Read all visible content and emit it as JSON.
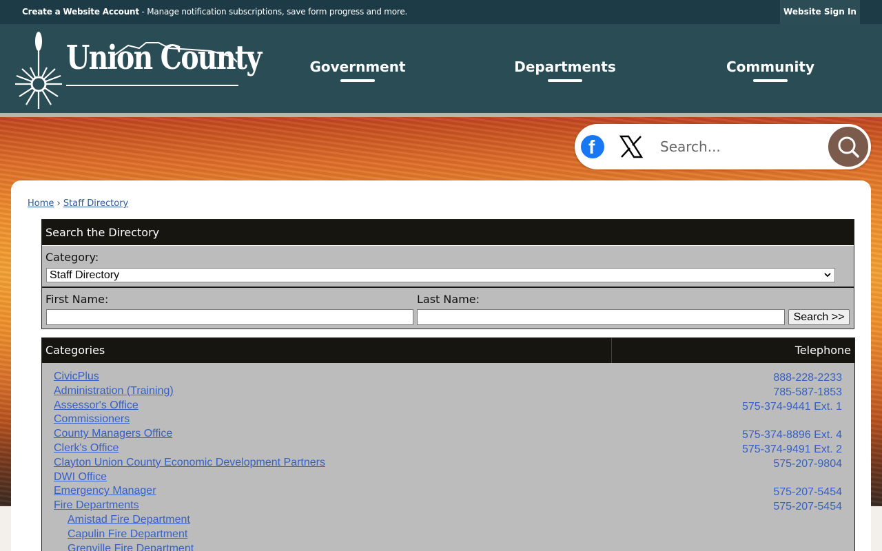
{
  "topbar": {
    "account_link": "Create a Website Account",
    "account_message": " - Manage notification subscriptions, save form progress and more.",
    "signin": "Website Sign In"
  },
  "logo": {
    "text": "Union County"
  },
  "nav": {
    "items": [
      "Government",
      "Departments",
      "Community"
    ]
  },
  "search": {
    "placeholder": "Search..."
  },
  "social": {
    "facebook_glyph": "f"
  },
  "breadcrumb": {
    "home": "Home",
    "sep": "›",
    "current": "Staff Directory"
  },
  "directory": {
    "heading": "Search the Directory",
    "category_label": "Category:",
    "category_selected": "Staff Directory",
    "first_name_label": "First Name:",
    "last_name_label": "Last Name:",
    "search_button": "Search >>"
  },
  "categories": {
    "col_categories": "Categories",
    "col_telephone": "Telephone",
    "rows": [
      {
        "name": "CivicPlus",
        "phone": "888-228-2233"
      },
      {
        "name": "Administration (Training)",
        "phone": "785-587-1853"
      },
      {
        "name": "Assessor's Office",
        "phone": "575-374-9441 Ext. 1"
      },
      {
        "name": "Commissioners",
        "phone": ""
      },
      {
        "name": "County Managers Office",
        "phone": "575-374-8896 Ext. 4"
      },
      {
        "name": "Clerk's Office",
        "phone": "575-374-9491 Ext. 2"
      },
      {
        "name": "Clayton Union County Economic Development Partners",
        "phone": "575-207-9804"
      },
      {
        "name": "DWI Office",
        "phone": ""
      },
      {
        "name": "Emergency Manager",
        "phone": "575-207-5454"
      },
      {
        "name": "Fire Departments",
        "phone": "575-207-5454"
      },
      {
        "name": "Amistad Fire Department",
        "phone": "",
        "sub": true
      },
      {
        "name": "Capulin Fire Department",
        "phone": "",
        "sub": true
      },
      {
        "name": "Grenville Fire Department",
        "phone": "",
        "sub": true
      }
    ]
  },
  "colors": {
    "topbar": "#1c3b46",
    "header": "#2a4c55",
    "table_header": "#16150f",
    "panel_bg": "#bcbcbc",
    "link": "#3560c6",
    "search_button": "#7b5b4c"
  },
  "icons": [
    "sun-zia-logo-icon",
    "facebook-icon",
    "x-twitter-icon",
    "search-icon",
    "select-chevron-icon"
  ]
}
